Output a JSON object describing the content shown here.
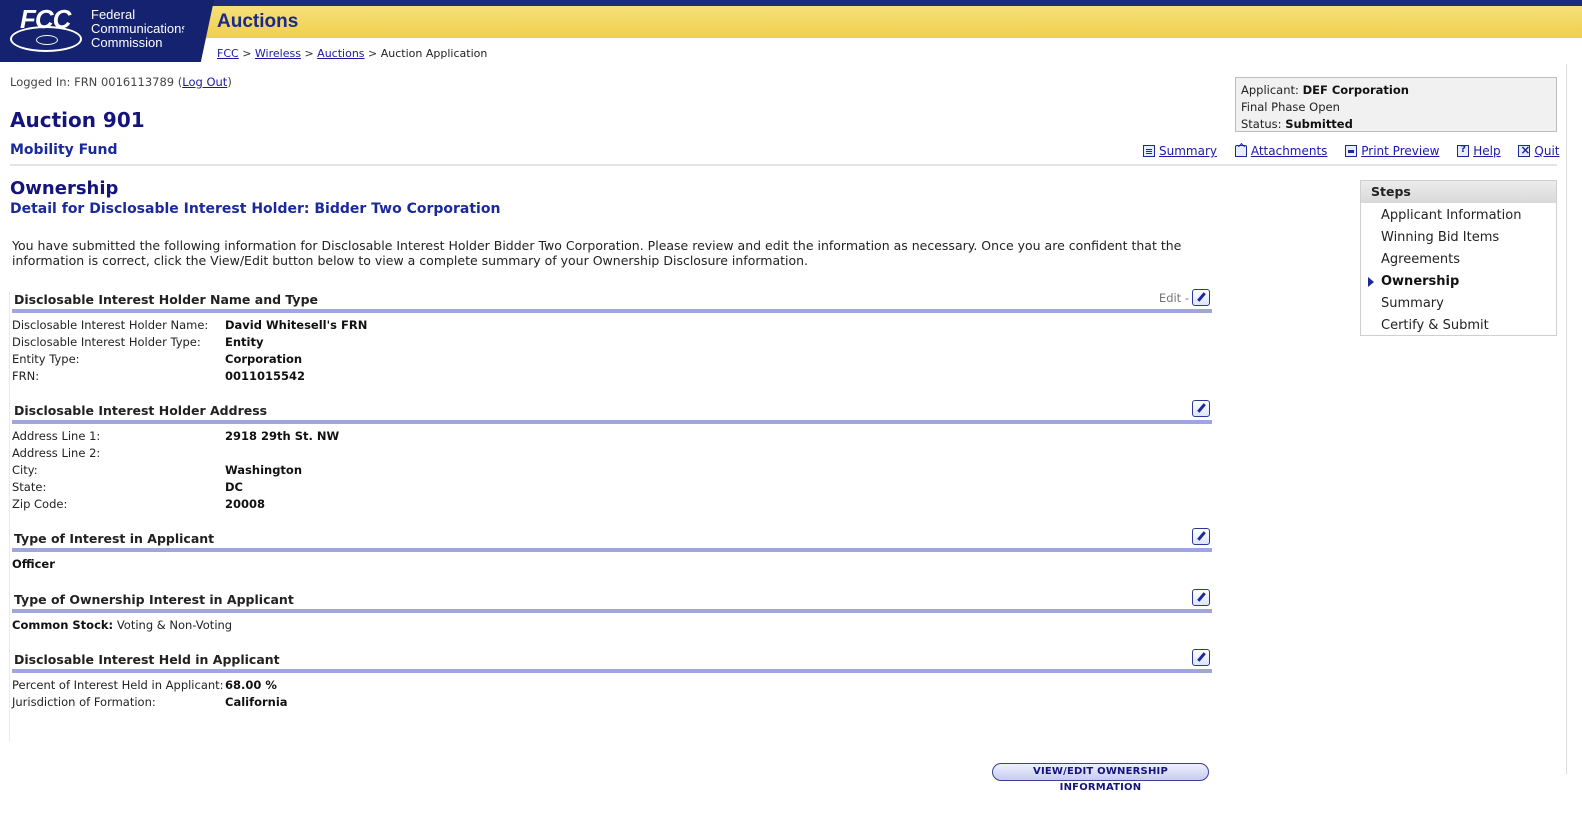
{
  "header": {
    "logo": {
      "abbr": "FCC",
      "line1": "Federal",
      "line2": "Communications",
      "line3": "Commission"
    },
    "app_title": "Auctions",
    "breadcrumb": {
      "fcc": "FCC",
      "wireless": "Wireless",
      "auctions": "Auctions",
      "current": "Auction Application",
      "sep": ">"
    }
  },
  "session": {
    "prefix": "Logged In: FRN 0016113789 (",
    "logout": "Log Out",
    "suffix": ")"
  },
  "auction": {
    "title": "Auction 901",
    "subtitle": "Mobility Fund"
  },
  "applicant_box": {
    "applicant_label": "Applicant:",
    "applicant_value": "DEF Corporation",
    "phase": "Final Phase Open",
    "status_label": "Status:",
    "status_value": "Submitted"
  },
  "toolbar": {
    "summary": "Summary",
    "attachments": "Attachments",
    "print_preview": "Print Preview",
    "help": "Help",
    "quit": "Quit"
  },
  "page": {
    "title": "Ownership",
    "subtitle": "Detail for Disclosable Interest Holder: Bidder Two Corporation",
    "intro": "You have submitted the following information for Disclosable Interest Holder Bidder Two Corporation. Please review and edit the information as necessary. Once you are confident that the information is correct, click the View/Edit button below to view a complete summary of your Ownership Disclosure information."
  },
  "sections": {
    "name_type": {
      "title": "Disclosable Interest Holder Name and Type",
      "edit_label": "Edit -",
      "rows": [
        {
          "k": "Disclosable Interest Holder Name:",
          "v": "David Whitesell's FRN"
        },
        {
          "k": "Disclosable Interest Holder Type:",
          "v": "Entity"
        },
        {
          "k": "Entity Type:",
          "v": "Corporation"
        },
        {
          "k": "FRN:",
          "v": "0011015542"
        }
      ]
    },
    "address": {
      "title": "Disclosable Interest Holder Address",
      "rows": [
        {
          "k": "Address Line 1:",
          "v": "2918 29th St. NW"
        },
        {
          "k": "Address Line 2:",
          "v": ""
        },
        {
          "k": "City:",
          "v": "Washington"
        },
        {
          "k": "State:",
          "v": "DC"
        },
        {
          "k": "Zip Code:",
          "v": "20008"
        }
      ]
    },
    "interest_type": {
      "title": "Type of Interest in Applicant",
      "value": "Officer"
    },
    "ownership_type": {
      "title": "Type of Ownership Interest in Applicant",
      "label": "Common Stock:",
      "value": "Voting & Non-Voting"
    },
    "interest_held": {
      "title": "Disclosable Interest Held in Applicant",
      "rows": [
        {
          "k": "Percent of Interest Held in Applicant:",
          "v": "68.00 %"
        },
        {
          "k": "Jurisdiction of Formation:",
          "v": "California"
        }
      ]
    }
  },
  "view_edit_button": "VIEW/EDIT OWNERSHIP INFORMATION",
  "steps": {
    "title": "Steps",
    "items": [
      "Applicant Information",
      "Winning Bid Items",
      "Agreements",
      "Ownership",
      "Summary",
      "Certify & Submit"
    ],
    "active_index": 3
  },
  "colors": {
    "navy": "#142270",
    "header_yellow": "#efcf4c",
    "title_blue": "#14147a",
    "rule_lavender": "#9fa5dd"
  },
  "icons": [
    "fcc-logo",
    "summary-icon",
    "attachments-icon",
    "print-icon",
    "help-icon",
    "quit-icon",
    "edit-icon",
    "step-arrow-icon"
  ]
}
